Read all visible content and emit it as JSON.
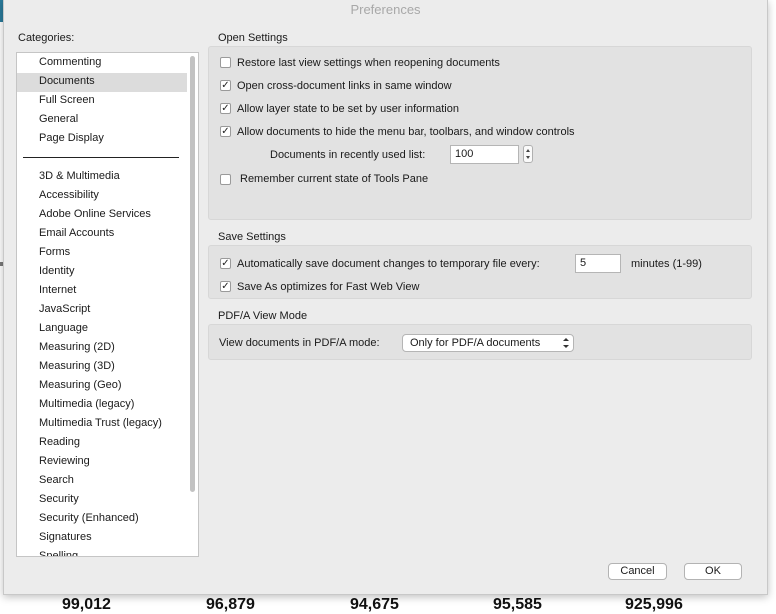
{
  "window": {
    "title": "Preferences"
  },
  "categories": {
    "label": "Categories:",
    "group1": [
      "Commenting",
      "Documents",
      "Full Screen",
      "General",
      "Page Display"
    ],
    "group2": [
      "3D & Multimedia",
      "Accessibility",
      "Adobe Online Services",
      "Email Accounts",
      "Forms",
      "Identity",
      "Internet",
      "JavaScript",
      "Language",
      "Measuring (2D)",
      "Measuring (3D)",
      "Measuring (Geo)",
      "Multimedia (legacy)",
      "Multimedia Trust (legacy)",
      "Reading",
      "Reviewing",
      "Search",
      "Security",
      "Security (Enhanced)",
      "Signatures",
      "Spelling"
    ],
    "selected": "Documents"
  },
  "open_settings": {
    "title": "Open Settings",
    "restore_last_view": {
      "label": "Restore last view settings when reopening documents",
      "checked": false
    },
    "cross_doc_links": {
      "label": "Open cross-document links in same window",
      "checked": true
    },
    "layer_state": {
      "label": "Allow layer state to be set by user information",
      "checked": true
    },
    "hide_menu_bar": {
      "label": "Allow documents to hide the menu bar, toolbars, and window controls",
      "checked": true
    },
    "recent_list_label": "Documents in recently used list:",
    "recent_list_value": "100",
    "remember_tools_pane": {
      "label": "Remember current state of Tools Pane",
      "checked": false
    }
  },
  "save_settings": {
    "title": "Save Settings",
    "autosave": {
      "label": "Automatically save document changes to temporary file every:",
      "checked": true
    },
    "autosave_minutes": "5",
    "minutes_suffix": "minutes (1-99)",
    "fast_web_view": {
      "label": "Save As optimizes for Fast Web View",
      "checked": true
    }
  },
  "pdfa": {
    "title": "PDF/A View Mode",
    "label": "View documents in PDF/A mode:",
    "selected": "Only for PDF/A documents"
  },
  "buttons": {
    "cancel": "Cancel",
    "ok": "OK"
  },
  "background_numbers": [
    "99,012",
    "96,879",
    "94,675",
    "95,585",
    "925,996"
  ],
  "check_glyph": "✓",
  "colors": {
    "selection": "#dcdcdc",
    "panel_bg": "#ececec",
    "group_bg": "#e2e2e2"
  }
}
